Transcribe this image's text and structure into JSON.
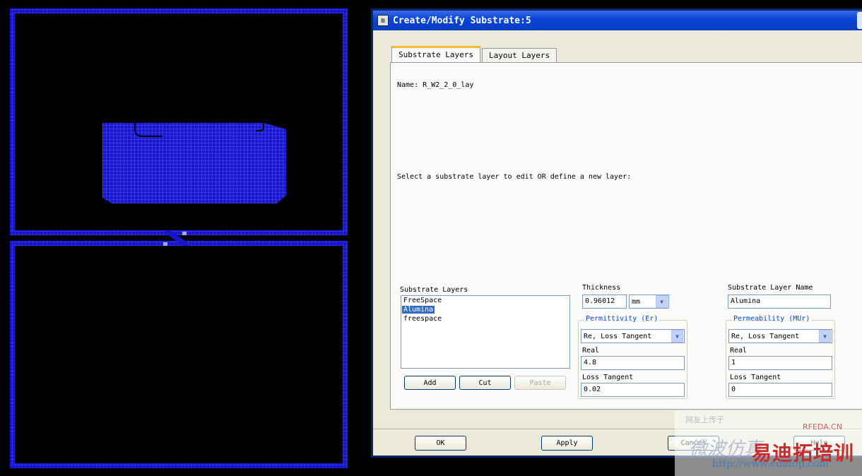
{
  "window": {
    "title": "Create/Modify Substrate:5"
  },
  "tabs": [
    {
      "label": "Substrate Layers",
      "active": true
    },
    {
      "label": "Layout Layers",
      "active": false
    }
  ],
  "name_line": "Name: R_W2_2_0_lay",
  "instruction": "Select a substrate layer to edit OR define a new layer:",
  "substrate_layers": {
    "label": "Substrate Layers",
    "items": [
      "FreeSpace",
      "Alumina",
      "freespace"
    ],
    "selected": "Alumina"
  },
  "list_buttons": {
    "add": "Add",
    "cut": "Cut",
    "paste": "Paste"
  },
  "thickness": {
    "label": "Thickness",
    "value": "0.96012",
    "unit": "mm"
  },
  "layer_name": {
    "label": "Substrate Layer Name",
    "value": "Alumina"
  },
  "permittivity": {
    "label": "Permittivity (Er)",
    "mode": "Re, Loss Tangent",
    "real_label": "Real",
    "real_value": "4.8",
    "loss_label": "Loss Tangent",
    "loss_value": "0.02"
  },
  "permeability": {
    "label": "Permeability (MUr)",
    "mode": "Re, Loss Tangent",
    "real_label": "Real",
    "real_value": "1",
    "loss_label": "Loss Tangent",
    "loss_value": "0"
  },
  "footer_buttons": {
    "ok": "OK",
    "apply": "Apply",
    "cancel": "Cancel",
    "help": "Help"
  },
  "watermark": {
    "line1": "网友上传于",
    "line2": "RFEDA.CN",
    "line3": "易迪拓培训",
    "line4": "http://www.edatop.com",
    "line5": "微波仿真"
  },
  "colors": {
    "layout_metal": "#1414c8",
    "title_bar": "#0a46d8",
    "selection": "#316ac5",
    "group_label": "#0046d5"
  }
}
